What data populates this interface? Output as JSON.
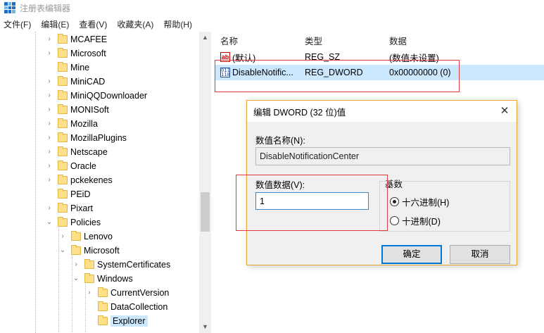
{
  "window": {
    "title": "注册表编辑器"
  },
  "menu": [
    "文件(F)",
    "编辑(E)",
    "查看(V)",
    "收藏夹(A)",
    "帮助(H)"
  ],
  "tree": [
    {
      "label": "MCAFEE",
      "expander": "right"
    },
    {
      "label": "Microsoft",
      "expander": "right"
    },
    {
      "label": "Mine",
      "expander": ""
    },
    {
      "label": "MiniCAD",
      "expander": "right"
    },
    {
      "label": "MiniQQDownloader",
      "expander": "right"
    },
    {
      "label": "MONISoft",
      "expander": "right"
    },
    {
      "label": "Mozilla",
      "expander": "right"
    },
    {
      "label": "MozillaPlugins",
      "expander": "right"
    },
    {
      "label": "Netscape",
      "expander": "right"
    },
    {
      "label": "Oracle",
      "expander": "right"
    },
    {
      "label": "pckekenes",
      "expander": "right"
    },
    {
      "label": "PEiD",
      "expander": ""
    },
    {
      "label": "Pixart",
      "expander": "right"
    },
    {
      "label": "Policies",
      "expander": "down"
    },
    {
      "label": "Lenovo",
      "expander": "right"
    },
    {
      "label": "Microsoft",
      "expander": "down"
    },
    {
      "label": "SystemCertificates",
      "expander": "right"
    },
    {
      "label": "Windows",
      "expander": "down"
    },
    {
      "label": "CurrentVersion",
      "expander": "right"
    },
    {
      "label": "DataCollection",
      "expander": ""
    },
    {
      "label": "Explorer",
      "expander": "",
      "selected": true
    }
  ],
  "list": {
    "headers": [
      "名称",
      "类型",
      "数据"
    ],
    "rows": [
      {
        "icon": "string-value-icon",
        "name": "(默认)",
        "type": "REG_SZ",
        "data": "(数值未设置)"
      },
      {
        "icon": "binary-value-icon",
        "name": "DisableNotific...",
        "type": "REG_DWORD",
        "data": "0x00000000 (0)",
        "selected": true
      }
    ]
  },
  "dialog": {
    "title": "编辑 DWORD (32 位)值",
    "name_label": "数值名称(N):",
    "name_value": "DisableNotificationCenter",
    "data_label": "数值数据(V):",
    "data_value": "1",
    "base_label": "基数",
    "hex_label": "十六进制(H)",
    "dec_label": "十进制(D)",
    "ok_label": "确定",
    "cancel_label": "取消",
    "selected_base": "hex"
  },
  "colors": {
    "highlight": "#e0393e",
    "selection": "#cce8ff",
    "accent": "#0078d7"
  }
}
